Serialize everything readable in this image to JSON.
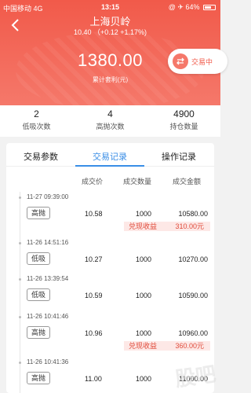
{
  "status_bar": {
    "carrier": "中国移动  4G",
    "time": "13:15",
    "right": "@ ✈ 64%",
    "battery_level": 0.64
  },
  "header": {
    "title": "上海贝岭",
    "subtitle": "10.40 （+0.12  +1.17%)",
    "profit_value": "1380.00",
    "profit_label": "累计套利(元)",
    "trade_button_label": "交易中"
  },
  "stats": [
    {
      "value": "2",
      "label": "低吸次数"
    },
    {
      "value": "4",
      "label": "高抛次数"
    },
    {
      "value": "4900",
      "label": "持仓数量"
    }
  ],
  "tabs": [
    {
      "label": "交易参数"
    },
    {
      "label": "交易记录"
    },
    {
      "label": "操作记录"
    }
  ],
  "active_tab": 1,
  "columns": [
    "成交价",
    "成交数量",
    "成交金额"
  ],
  "records": [
    {
      "time": "11-27 09:39:00",
      "type": "高抛",
      "price": "10.58",
      "qty": "1000",
      "amount": "10580.00",
      "profit_label": "兑现收益",
      "profit_value": "310.00元"
    },
    {
      "time": "11-26 14:51:16",
      "type": "低吸",
      "price": "10.27",
      "qty": "1000",
      "amount": "10270.00"
    },
    {
      "time": "11-26 13:39:54",
      "type": "低吸",
      "price": "10.59",
      "qty": "1000",
      "amount": "10590.00"
    },
    {
      "time": "11-26 10:41:46",
      "type": "高抛",
      "price": "10.96",
      "qty": "1000",
      "amount": "10960.00",
      "profit_label": "兑现收益",
      "profit_value": "360.00元"
    },
    {
      "time": "11-26 10:41:36",
      "type": "高抛",
      "price": "11.00",
      "qty": "1000",
      "amount": "11000.00"
    }
  ],
  "watermark": "股吧",
  "colors": {
    "brand_red": "#f15a4a",
    "tab_blue": "#3a8ee6"
  }
}
